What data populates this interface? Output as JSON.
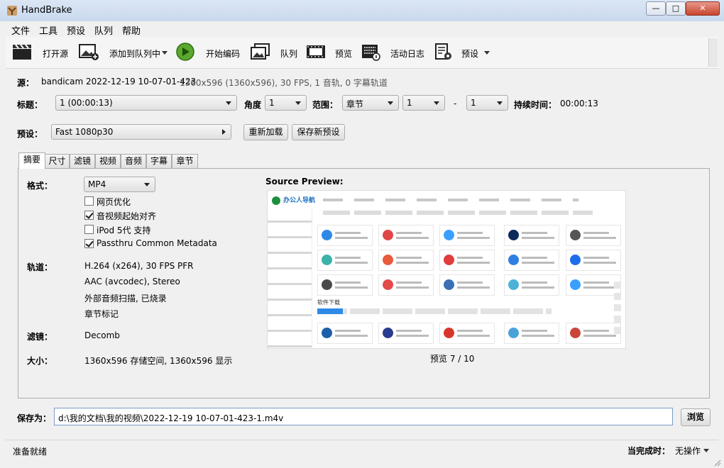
{
  "window": {
    "title": "HandBrake",
    "min": "—",
    "max": "□",
    "close": "✕"
  },
  "menu": [
    "文件",
    "工具",
    "预设",
    "队列",
    "帮助"
  ],
  "toolbar": {
    "open_source": "打开源",
    "add_queue": "添加到队列中",
    "start_encode": "开始编码",
    "queue": "队列",
    "preview": "预览",
    "activity_log": "活动日志",
    "presets": "预设"
  },
  "source": {
    "label": "源：",
    "name": "bandicam 2022-12-19 10-07-01-423",
    "info": "1360x596 (1360x596), 30 FPS, 1 音轨, 0 字幕轨道"
  },
  "title_row": {
    "title_label": "标题：",
    "title_value": "1  (00:00:13)",
    "angle_label": "角度",
    "angle_value": "1",
    "range_label": "范围：",
    "range_type": "章节",
    "range_start": "1",
    "range_sep": "-",
    "range_end": "1",
    "duration_label": "持续时间：",
    "duration_value": "00:00:13"
  },
  "preset_row": {
    "label": "预设：",
    "value": "Fast 1080p30",
    "reload": "重新加载",
    "save_new": "保存新预设"
  },
  "tabs": [
    "摘要",
    "尺寸",
    "滤镜",
    "视频",
    "音频",
    "字幕",
    "章节"
  ],
  "summary": {
    "format_label": "格式：",
    "format_value": "MP4",
    "checkboxes": [
      {
        "label": "网页优化",
        "checked": false
      },
      {
        "label": "音视频起始对齐",
        "checked": true
      },
      {
        "label": "iPod 5代 支持",
        "checked": false
      },
      {
        "label": "Passthru Common Metadata",
        "checked": true
      }
    ],
    "tracks_label": "轨道：",
    "tracks": [
      "H.264 (x264), 30 FPS PFR",
      "AAC (avcodec), Stereo",
      "外部音频扫描, 已烧录",
      "章节标记"
    ],
    "filters_label": "滤镜：",
    "filters_value": "Decomb",
    "size_label": "大小：",
    "size_value": "1360x596 存储空间, 1360x596 显示",
    "preview_title": "Source Preview:",
    "preview_counter": "预览 7 / 10",
    "preview_site": {
      "logo": "办公人导航",
      "section": "软件下载"
    }
  },
  "save": {
    "label": "保存为：",
    "path": "d:\\我的文档\\我的视频\\2022-12-19 10-07-01-423-1.m4v",
    "browse": "浏览"
  },
  "status": {
    "ready": "准备就绪",
    "when_done_label": "当完成时：",
    "when_done_value": "无操作"
  }
}
